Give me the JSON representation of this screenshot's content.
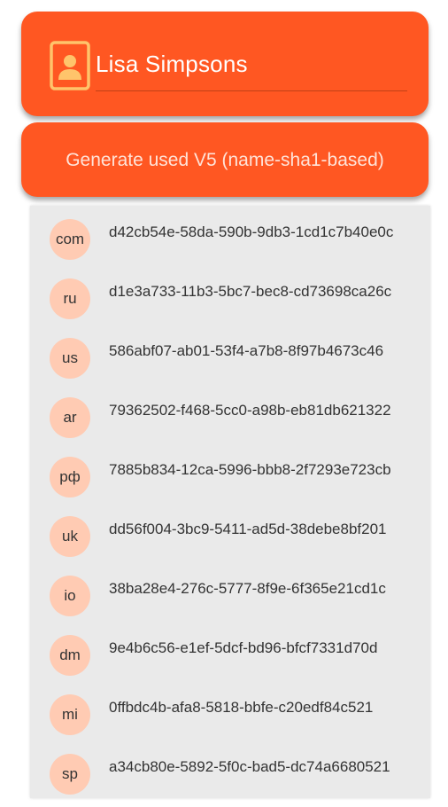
{
  "name_field": {
    "value": "Lisa Simpsons",
    "icon": "contact-card-icon"
  },
  "generate_button": {
    "label": "Generate used V5 (name-sha1-based)"
  },
  "colors": {
    "accent": "#ff5722",
    "badge": "#ffcbb3",
    "panel": "#eaeaea"
  },
  "list": [
    {
      "tld": "com",
      "uuid": "d42cb54e-58da-590b-9db3-1cd1c7b40e0c"
    },
    {
      "tld": "ru",
      "uuid": "d1e3a733-11b3-5bc7-bec8-cd73698ca26c"
    },
    {
      "tld": "us",
      "uuid": "586abf07-ab01-53f4-a7b8-8f97b4673c46"
    },
    {
      "tld": "ar",
      "uuid": "79362502-f468-5cc0-a98b-eb81db621322"
    },
    {
      "tld": "рф",
      "uuid": "7885b834-12ca-5996-bbb8-2f7293e723cb"
    },
    {
      "tld": "uk",
      "uuid": "dd56f004-3bc9-5411-ad5d-38debe8bf201"
    },
    {
      "tld": "io",
      "uuid": "38ba28e4-276c-5777-8f9e-6f365e21cd1c"
    },
    {
      "tld": "dm",
      "uuid": "9e4b6c56-e1ef-5dcf-bd96-bfcf7331d70d"
    },
    {
      "tld": "mi",
      "uuid": "0ffbdc4b-afa8-5818-bbfe-c20edf84c521"
    },
    {
      "tld": "sp",
      "uuid": "a34cb80e-5892-5f0c-bad5-dc74a6680521"
    }
  ]
}
